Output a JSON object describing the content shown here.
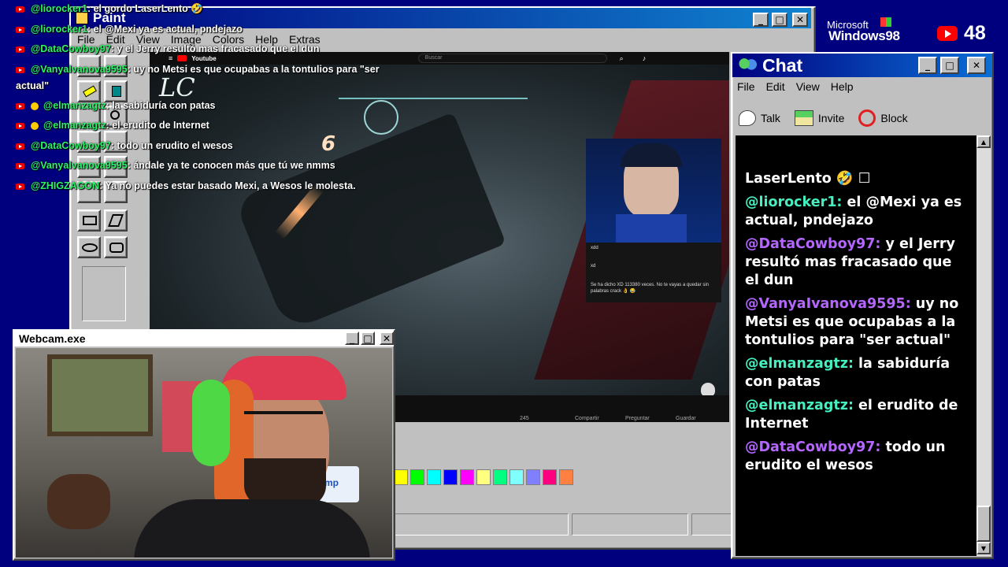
{
  "branding": {
    "microsoft": "Microsoft",
    "windows": "Windows98",
    "viewers": "48"
  },
  "paint": {
    "title": "Paint",
    "menu": [
      "File",
      "Edit",
      "View",
      "Image",
      "Colors",
      "Help",
      "Extras"
    ],
    "palette": [
      "#ffff00",
      "#00ff00",
      "#00ffff",
      "#0000ff",
      "#ff00ff",
      "#ffff80",
      "#00ff80",
      "#80ffff",
      "#8080ff",
      "#ff0080",
      "#ff8040"
    ]
  },
  "video": {
    "site": "Youtube",
    "search": "Buscar",
    "tag": "LC",
    "number": "6",
    "stream_chat": [
      "xdd",
      "xd",
      "Se ha dicho XD 113380 veces. No te vayas a quedar sin palabras crack 👌 😂"
    ],
    "actions": [
      "245",
      "Compartir",
      "Preguntar",
      "Guardar"
    ]
  },
  "webcam": {
    "title": "Webcam.exe",
    "shelf_label": "Kimp"
  },
  "overlay": [
    {
      "user": "@liorocker1",
      "text": ": el gordo LaserLento 🤣"
    },
    {
      "user": "@liorocker1",
      "text": ": el @Mexi ya es actual, pndejazo"
    },
    {
      "user": "@DataCowboy97",
      "text": ": y el Jerry resultó mas fracasado que el dun"
    },
    {
      "user": "@Vanyalvanova9595",
      "text": ": uy no Metsi es que ocupabas a la tontulios para \"ser"
    },
    {
      "user": "",
      "text": "actual\""
    },
    {
      "user": "@elmanzagtz",
      "text": ": la sabiduría con patas"
    },
    {
      "user": "@elmanzagtz",
      "text": ": el erudito de Internet"
    },
    {
      "user": "@DataCowboy97",
      "text": ": todo un erudito el wesos"
    },
    {
      "user": "@Vanyalvanova9595",
      "text": ": ándale ya te conocen más que tú we nmms"
    },
    {
      "user": "@ZHIGZAGON",
      "text": ": Ya no puedes estar basado Mexi, a Wesos le molesta."
    }
  ],
  "chat": {
    "title": "Chat",
    "menu": [
      "File",
      "Edit",
      "View",
      "Help"
    ],
    "toolbar": [
      "Talk",
      "Invite",
      "Block"
    ],
    "messages": [
      {
        "user": "",
        "text": "LaserLento 🤣 ☐"
      },
      {
        "user": "@liorocker1:",
        "text": " el @Mexi ya es actual, pndejazo"
      },
      {
        "user": "@DataCowboy97:",
        "text": " y el Jerry resultó mas fracasado que el dun"
      },
      {
        "user": "@VanyaIvanova9595:",
        "text": " uy no Metsi es que ocupabas a la tontulios para \"ser actual\""
      },
      {
        "user": "@elmanzagtz:",
        "text": " la sabiduría con patas"
      },
      {
        "user": "@elmanzagtz:",
        "text": " el erudito de Internet"
      },
      {
        "user": "@DataCowboy97:",
        "text": " todo un erudito el wesos"
      }
    ]
  }
}
